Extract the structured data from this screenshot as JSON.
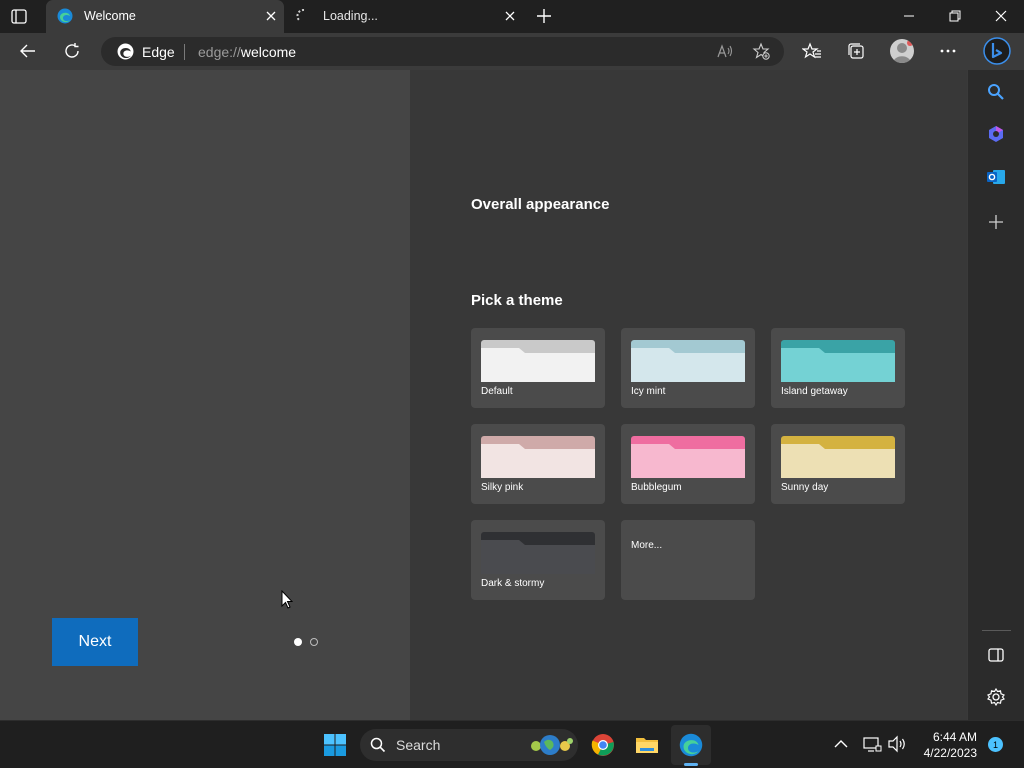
{
  "browser": {
    "tabs": [
      {
        "title": "Welcome",
        "state": "active"
      },
      {
        "title": "Loading...",
        "state": "loading"
      }
    ],
    "address": {
      "site_label": "Edge",
      "url_scheme": "edge://",
      "url_path": "welcome"
    }
  },
  "welcome": {
    "overall_appearance": "Overall appearance",
    "pick_theme": "Pick a theme",
    "themes": [
      {
        "label": "Default",
        "back": "#c9c9c9",
        "front": "#f2f2f2"
      },
      {
        "label": "Icy mint",
        "back": "#a3c9d2",
        "front": "#d4e7ec"
      },
      {
        "label": "Island getaway",
        "back": "#3aa3a6",
        "front": "#74d2d4"
      },
      {
        "label": "Silky pink",
        "back": "#cfaaa9",
        "front": "#f2e4e3"
      },
      {
        "label": "Bubblegum",
        "back": "#ef6da0",
        "front": "#f7b8cf"
      },
      {
        "label": "Sunny day",
        "back": "#d4b240",
        "front": "#ede0b4"
      },
      {
        "label": "Dark & stormy",
        "back": "#2f3033",
        "front": "#4a4b4f"
      },
      {
        "label": "More..."
      }
    ],
    "next_label": "Next"
  },
  "taskbar": {
    "search_label": "Search",
    "time": "6:44 AM",
    "date": "4/22/2023",
    "notification_count": "1"
  },
  "colors": {
    "accent": "#0f6cbd"
  }
}
